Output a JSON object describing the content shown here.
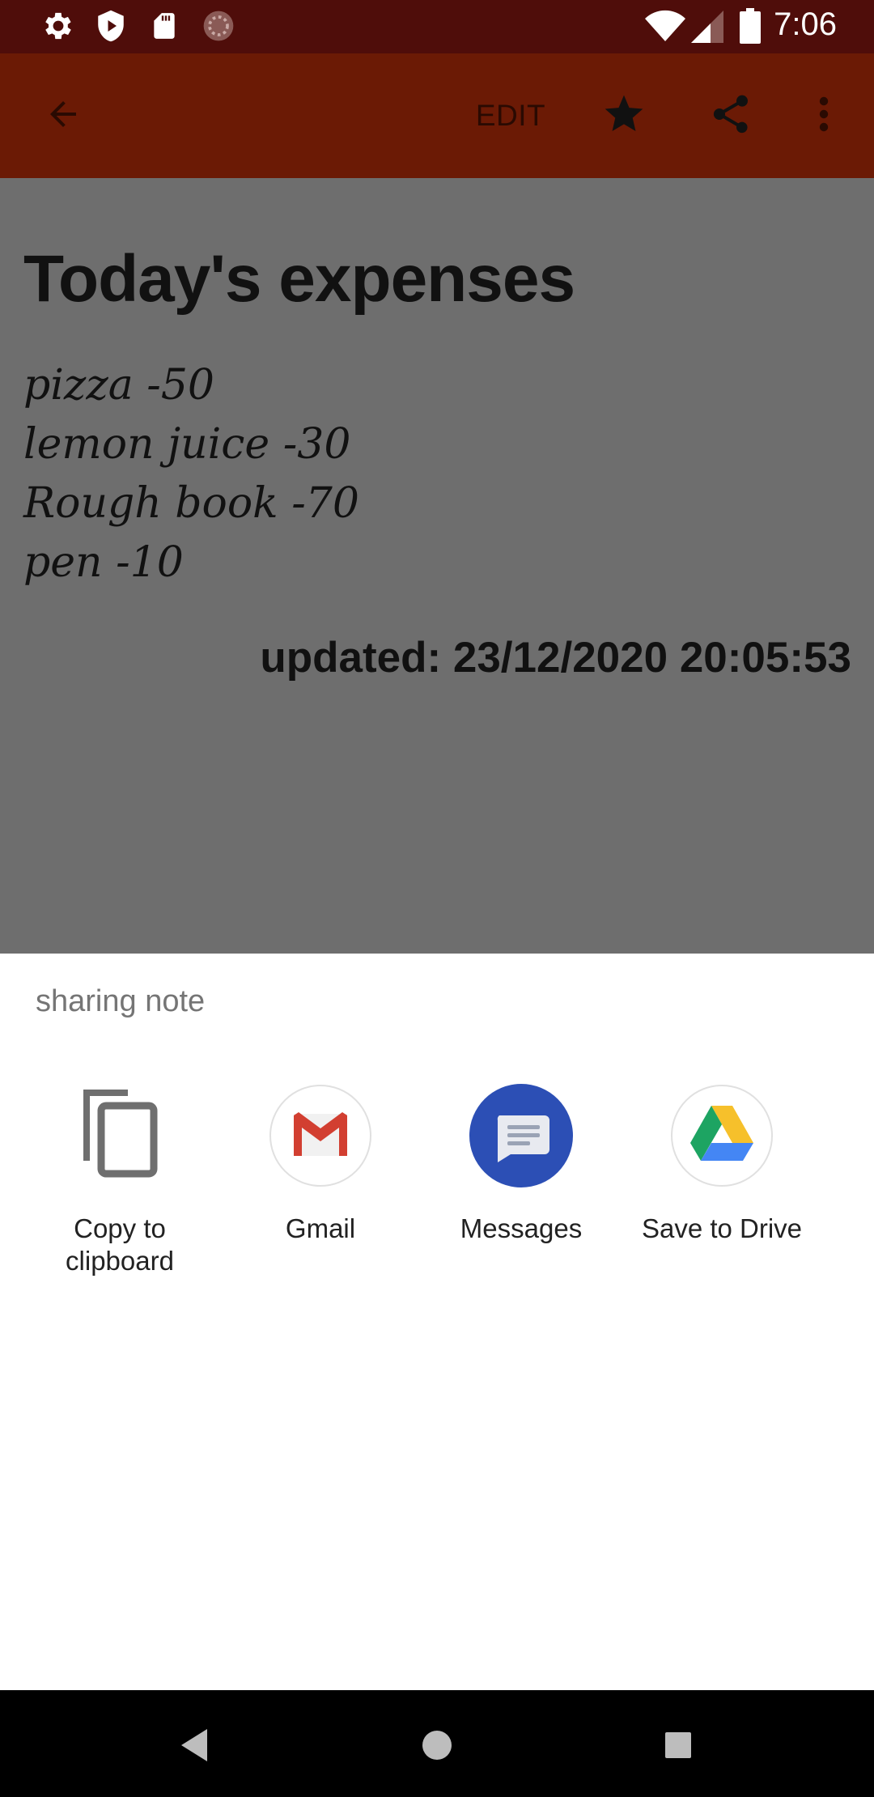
{
  "status_bar": {
    "time": "7:06",
    "left_icons": [
      "settings-icon",
      "shield-play-icon",
      "sd-card-icon",
      "sync-circle-icon"
    ],
    "right_icons": [
      "wifi-icon",
      "cell-signal-icon",
      "battery-icon"
    ]
  },
  "toolbar": {
    "edit_label": "EDIT",
    "icons": [
      "back-arrow-icon",
      "star-icon",
      "share-icon",
      "more-vert-icon"
    ]
  },
  "note": {
    "title": "Today's expenses",
    "lines": [
      "pizza -50",
      "lemon juice -30",
      "Rough book -70",
      "pen -10"
    ],
    "updated": "updated: 23/12/2020 20:05:53"
  },
  "share_sheet": {
    "title": "sharing note",
    "targets": [
      {
        "label": "Copy to\nclipboard",
        "icon": "copy-icon"
      },
      {
        "label": "Gmail",
        "icon": "gmail-icon"
      },
      {
        "label": "Messages",
        "icon": "messages-icon"
      },
      {
        "label": "Save to Drive",
        "icon": "drive-icon"
      }
    ]
  },
  "colors": {
    "status_bar": "#4f0d0a",
    "toolbar": "#6b1a05",
    "scrim_content": "#6e6e6e",
    "sheet": "#ffffff",
    "nav_bar": "#000000"
  },
  "nav_bar": {
    "icons": [
      "back-triangle-icon",
      "home-circle-icon",
      "recents-square-icon"
    ]
  }
}
